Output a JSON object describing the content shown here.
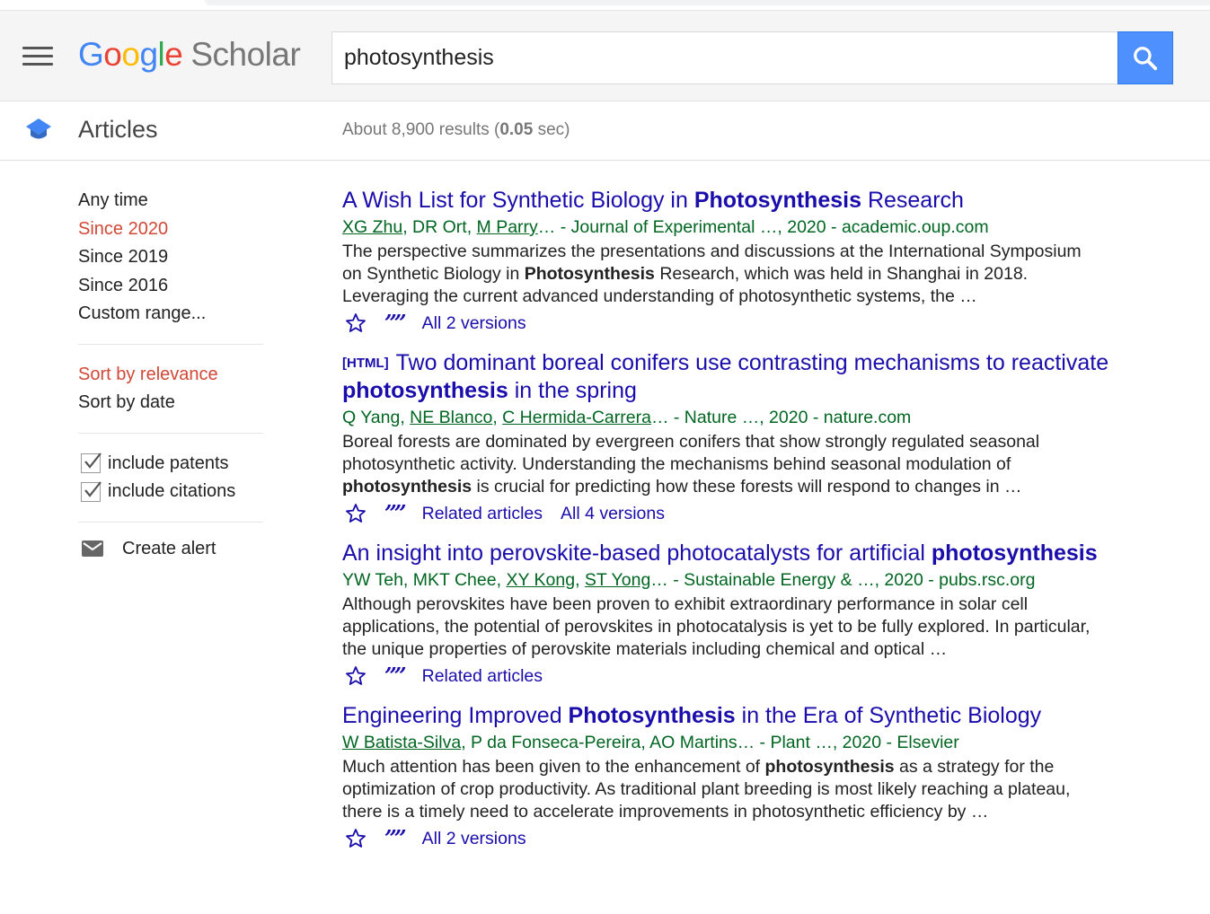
{
  "search": {
    "query": "photosynthesis"
  },
  "logo": {
    "google_letters": [
      "G",
      "o",
      "o",
      "g",
      "l",
      "e"
    ],
    "scholar": "Scholar"
  },
  "subheader": {
    "section": "Articles",
    "results_prefix": "About 8,900 results (",
    "results_time": "0.05",
    "results_suffix": " sec)"
  },
  "sidebar": {
    "time_filters": [
      "Any time",
      "Since 2020",
      "Since 2019",
      "Since 2016",
      "Custom range..."
    ],
    "sort_options": [
      "Sort by relevance",
      "Sort by date"
    ],
    "checks": [
      "include patents",
      "include citations"
    ],
    "alert": "Create alert"
  },
  "results": [
    {
      "tag": "",
      "title_parts": [
        "A Wish List for Synthetic Biology in ",
        "Photosynthesis",
        " Research"
      ],
      "authors": [
        {
          "text": "XG Zhu",
          "link": true
        },
        {
          "text": ", DR Ort, ",
          "link": false
        },
        {
          "text": "M Parry",
          "link": true
        },
        {
          "text": "… - Journal of Experimental …, 2020 - academic.oup.com",
          "link": false
        }
      ],
      "snippet_parts": [
        "The perspective summarizes the presentations and discussions at the International Symposium on Synthetic Biology in ",
        "Photosynthesis",
        " Research, which was held in Shanghai in 2018. Leveraging the current advanced understanding of photosynthetic systems, the …"
      ],
      "actions": [
        "All 2 versions"
      ]
    },
    {
      "tag": "[HTML]",
      "title_parts": [
        "Two dominant boreal conifers use contrasting mechanisms to reactivate ",
        "photosynthesis",
        " in the spring"
      ],
      "authors": [
        {
          "text": "Q Yang, ",
          "link": false
        },
        {
          "text": "NE Blanco",
          "link": true
        },
        {
          "text": ", ",
          "link": false
        },
        {
          "text": "C Hermida-Carrera",
          "link": true
        },
        {
          "text": "… - Nature …, 2020 - nature.com",
          "link": false
        }
      ],
      "snippet_parts": [
        "Boreal forests are dominated by evergreen conifers that show strongly regulated seasonal photosynthetic activity. Understanding the mechanisms behind seasonal modulation of ",
        "photosynthesis",
        " is crucial for predicting how these forests will respond to changes in …"
      ],
      "actions": [
        "Related articles",
        "All 4 versions"
      ]
    },
    {
      "tag": "",
      "title_parts": [
        "An insight into perovskite-based photocatalysts for artificial ",
        "photosynthesis",
        ""
      ],
      "authors": [
        {
          "text": "YW Teh, MKT Chee, ",
          "link": false
        },
        {
          "text": "XY Kong",
          "link": true
        },
        {
          "text": ", ",
          "link": false
        },
        {
          "text": "ST Yong",
          "link": true
        },
        {
          "text": "… - Sustainable Energy & …, 2020 - pubs.rsc.org",
          "link": false
        }
      ],
      "snippet_parts": [
        "Although perovskites have been proven to exhibit extraordinary performance in solar cell applications, the potential of perovskites in photocatalysis is yet to be fully explored. In particular, the unique properties of perovskite materials including chemical and optical …",
        "",
        ""
      ],
      "actions": [
        "Related articles"
      ]
    },
    {
      "tag": "",
      "title_parts": [
        "Engineering Improved ",
        "Photosynthesis",
        " in the Era of Synthetic Biology"
      ],
      "authors": [
        {
          "text": "W Batista-Silva",
          "link": true
        },
        {
          "text": ", P da Fonseca-Pereira, AO Martins… - Plant …, 2020 - Elsevier",
          "link": false
        }
      ],
      "snippet_parts": [
        "Much attention has been given to the enhancement of ",
        "photosynthesis",
        " as a strategy for the optimization of crop productivity. As traditional plant breeding is most likely reaching a plateau, there is a timely need to accelerate improvements in photosynthetic efficiency by …"
      ],
      "actions": [
        "All 2 versions"
      ]
    }
  ],
  "icons": {
    "menu": "hamburger-menu-icon",
    "search": "magnifier-icon",
    "cap": "graduation-cap-icon",
    "star": "star-outline-icon",
    "quote": "cite-quote-icon",
    "mail": "envelope-icon"
  },
  "colors": {
    "link": "#1a0dab",
    "green": "#006621",
    "active": "#d14836",
    "search_button": "#4d90fe"
  }
}
